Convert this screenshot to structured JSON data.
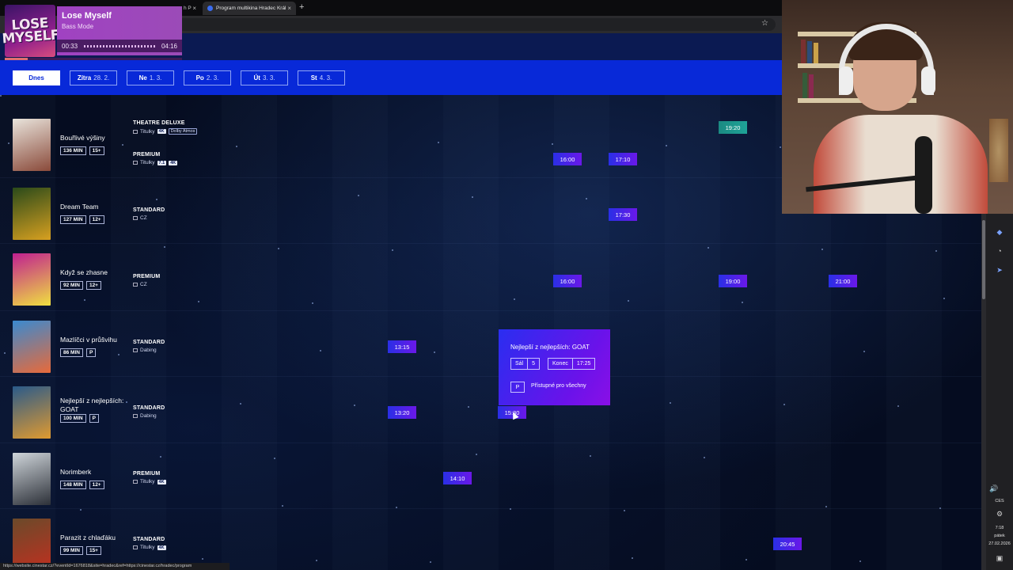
{
  "browser": {
    "active_tab_label": "Program multikina Hradec Král",
    "inactive_tab_label": "h P",
    "status_url": "https://website.cinestar.cz/?eventId=1676818&site=hradec&ref=https://cinestar.cz/hradec/program"
  },
  "music": {
    "cover_text": "LOSE MYSELF",
    "title": "Lose Myself",
    "mode": "Bass Mode",
    "elapsed": "00:33",
    "total": "04:16",
    "progress": 0.13
  },
  "date_tabs": [
    {
      "label": "Dnes",
      "date": "",
      "active": true
    },
    {
      "label": "Zítra",
      "date": "28. 2.",
      "active": false
    },
    {
      "label": "Ne",
      "date": "1. 3.",
      "active": false
    },
    {
      "label": "Po",
      "date": "2. 3.",
      "active": false
    },
    {
      "label": "Út",
      "date": "3. 3.",
      "active": false
    },
    {
      "label": "St",
      "date": "4. 3.",
      "active": false
    }
  ],
  "movies": [
    {
      "title": "Bouřlivé výšiny",
      "duration": "136 MIN",
      "rating": "15+",
      "formats": [
        {
          "name": "THEATRE DELUXE",
          "lang": "Titulky",
          "chips": [
            "4K",
            "Dolby Atmos"
          ],
          "times": [
            "19:20"
          ]
        },
        {
          "name": "PREMIUM",
          "lang": "Titulky",
          "chips": [
            "7.1",
            "4K"
          ],
          "times": [
            "16:00",
            "17:10"
          ]
        }
      ]
    },
    {
      "title": "Dream Team",
      "duration": "127 MIN",
      "rating": "12+",
      "formats": [
        {
          "name": "STANDARD",
          "lang": "CZ",
          "chips": [],
          "times": [
            "17:30"
          ]
        }
      ]
    },
    {
      "title": "Když se zhasne",
      "duration": "92 MIN",
      "rating": "12+",
      "formats": [
        {
          "name": "PREMIUM",
          "lang": "CZ",
          "chips": [],
          "times": [
            "16:00",
            "19:00",
            "21:00"
          ]
        }
      ]
    },
    {
      "title": "Mazlíčci v průšvihu",
      "duration": "86 MIN",
      "rating": "P",
      "formats": [
        {
          "name": "STANDARD",
          "lang": "Dabing",
          "chips": [],
          "times": [
            "13:15"
          ]
        }
      ]
    },
    {
      "title": "Nejlepší z nejlepších: GOAT",
      "duration": "100 MIN",
      "rating": "P",
      "formats": [
        {
          "name": "STANDARD",
          "lang": "Dabing",
          "chips": [],
          "times": [
            "13:20",
            "15:30"
          ]
        }
      ]
    },
    {
      "title": "Norimberk",
      "duration": "148 MIN",
      "rating": "12+",
      "formats": [
        {
          "name": "PREMIUM",
          "lang": "Titulky",
          "chips": [
            "4K"
          ],
          "times": [
            "14:10"
          ]
        }
      ]
    },
    {
      "title": "Parazit z chlaďáku",
      "duration": "99 MIN",
      "rating": "15+",
      "formats": [
        {
          "name": "STANDARD",
          "lang": "Titulky",
          "chips": [
            "4K"
          ],
          "times": [
            "20:45"
          ]
        }
      ]
    }
  ],
  "tooltip": {
    "title": "Nejlepší z nejlepších: GOAT",
    "hall_label": "Sál",
    "hall_value": "5",
    "end_label": "Konec",
    "end_value": "17:25",
    "rating": "P",
    "rating_text": "Přístupné pro všechny"
  },
  "tray": {
    "lang": "CES",
    "time": "7:18",
    "day": "pátek",
    "date": "27.02.2026"
  },
  "colors": {
    "date_bar": "#0829d8",
    "slot_start": "#2a2fe6",
    "slot_end": "#6a18e8",
    "slot_highlight": "#1fa398",
    "music_panel": "#a042c2"
  }
}
